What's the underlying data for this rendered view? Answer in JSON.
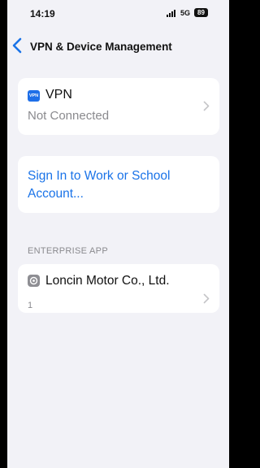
{
  "status_bar": {
    "time": "14:19",
    "network": "5G",
    "battery": "89"
  },
  "nav": {
    "title": "VPN & Device Management",
    "back_icon": "chevron-left-icon"
  },
  "vpn_row": {
    "icon_text": "VPN",
    "label": "VPN",
    "status": "Not Connected"
  },
  "sign_in": {
    "link": "Sign In to Work or School Account..."
  },
  "enterprise": {
    "section_header": "ENTERPRISE APP",
    "app_name": "Loncin Motor Co., Ltd.",
    "count": "1"
  },
  "colors": {
    "accent": "#1a73e8",
    "background": "#f2f2f7",
    "secondary_text": "#8a8a8e"
  }
}
